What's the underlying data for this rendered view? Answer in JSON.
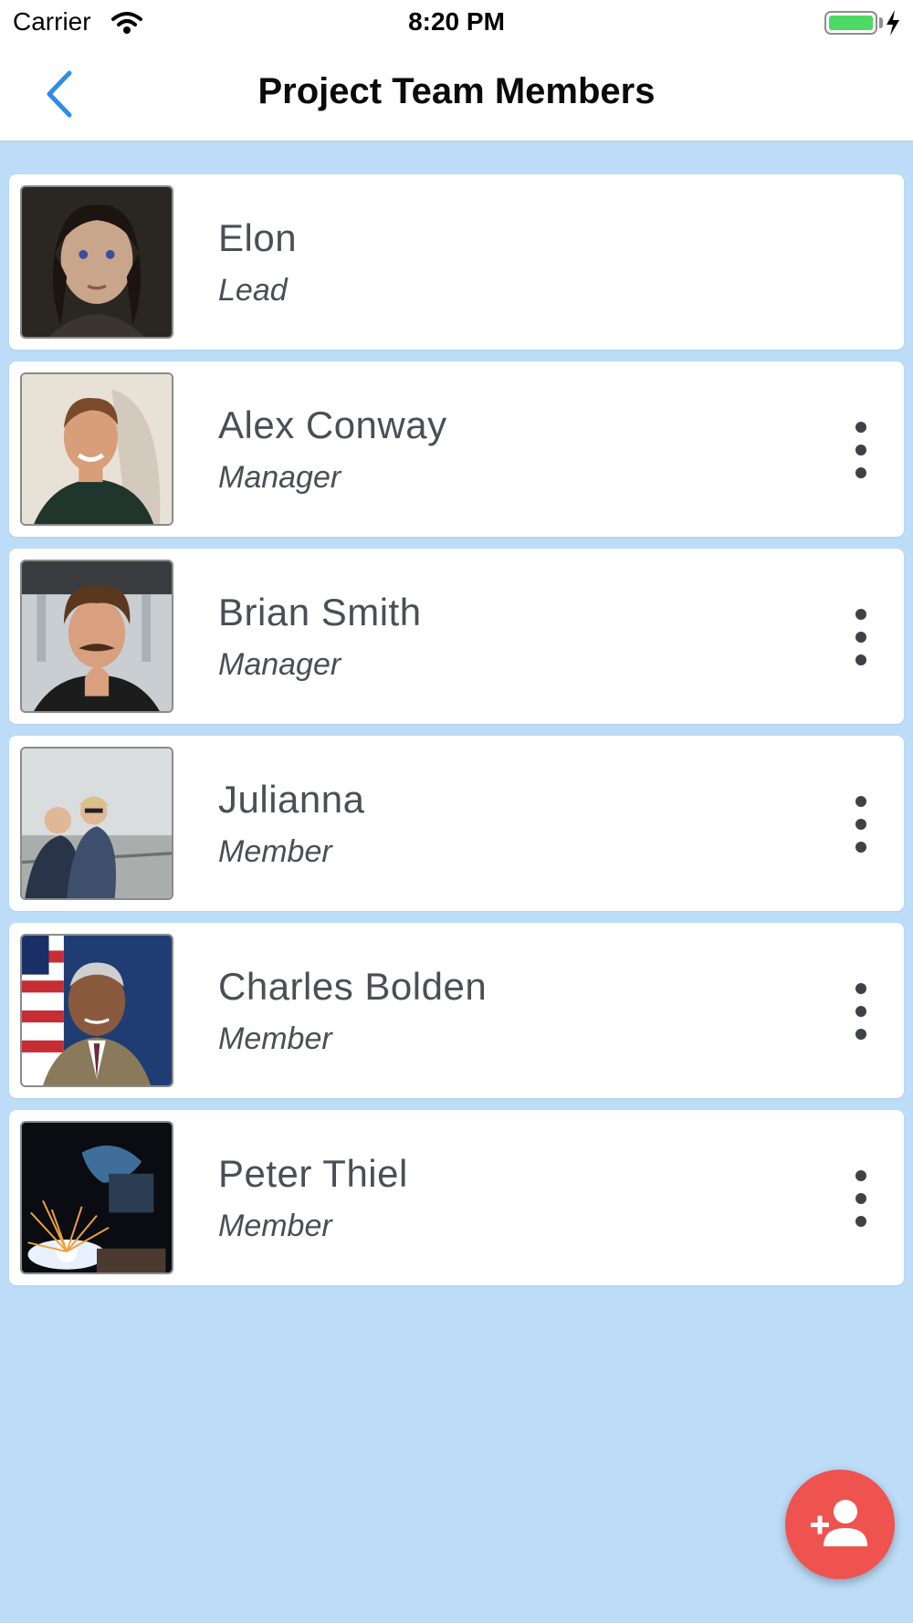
{
  "status_bar": {
    "carrier": "Carrier",
    "time": "8:20 PM",
    "battery_level": 1.0
  },
  "nav": {
    "title": "Project Team Members",
    "back_icon": "chevron-left-icon"
  },
  "members": [
    {
      "name": "Elon",
      "role": "Lead",
      "has_menu": false
    },
    {
      "name": "Alex Conway",
      "role": "Manager",
      "has_menu": true
    },
    {
      "name": "Brian Smith",
      "role": "Manager",
      "has_menu": true
    },
    {
      "name": "Julianna",
      "role": "Member",
      "has_menu": true
    },
    {
      "name": "Charles Bolden",
      "role": "Member",
      "has_menu": true
    },
    {
      "name": "Peter Thiel",
      "role": "Member",
      "has_menu": true
    }
  ],
  "fab": {
    "icon": "add-person-icon",
    "color": "#ef5350"
  },
  "colors": {
    "background": "#bcdcf7",
    "accent": "#2e8ee6",
    "card": "#ffffff",
    "text": "#4b4e55"
  }
}
